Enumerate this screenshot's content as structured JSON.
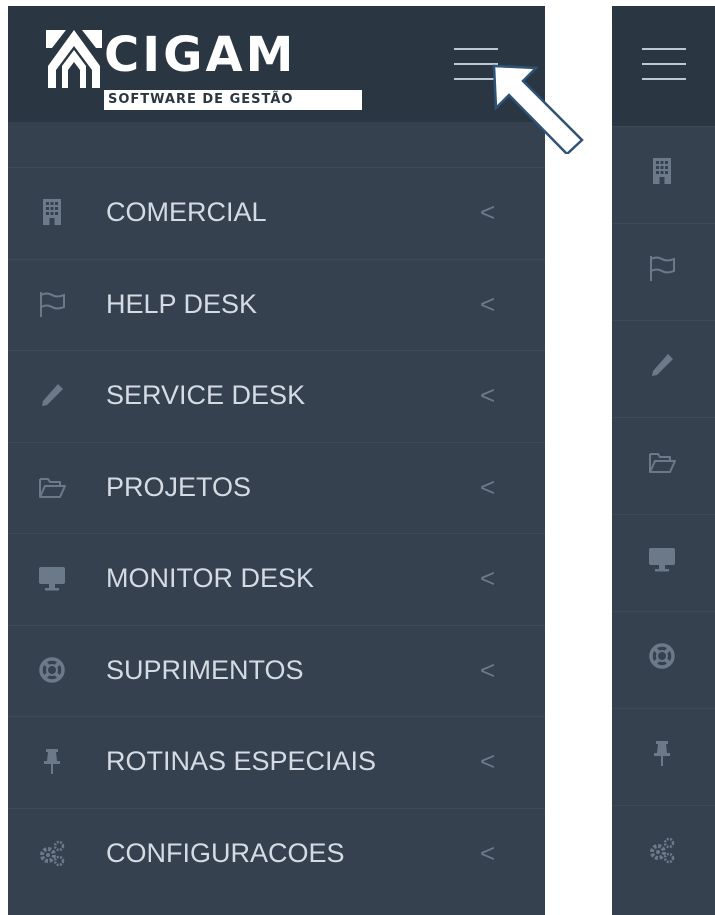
{
  "logo": {
    "name": "CIGAM",
    "tagline": "SOFTWARE DE GESTÃO"
  },
  "menu": {
    "items": [
      {
        "label": "COMERCIAL",
        "icon": "building-icon"
      },
      {
        "label": "HELP DESK",
        "icon": "flag-icon"
      },
      {
        "label": "SERVICE DESK",
        "icon": "pencil-icon"
      },
      {
        "label": "PROJETOS",
        "icon": "folder-open-icon"
      },
      {
        "label": "MONITOR DESK",
        "icon": "desktop-icon"
      },
      {
        "label": "SUPRIMENTOS",
        "icon": "life-ring-icon"
      },
      {
        "label": "ROTINAS ESPECIAIS",
        "icon": "pushpin-icon"
      },
      {
        "label": "CONFIGURACOES",
        "icon": "gears-icon"
      }
    ],
    "chevron": "<"
  },
  "colors": {
    "sidebar_bg": "#364150",
    "header_bg": "#2b3643",
    "text": "#d4dbe3",
    "icon": "#6c7988"
  }
}
